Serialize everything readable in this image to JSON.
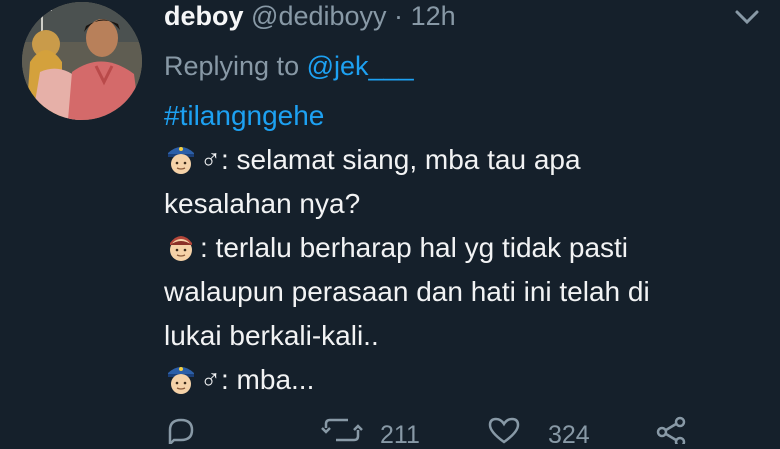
{
  "tweet": {
    "display_name": "deboy",
    "handle": "@dediboyy",
    "separator": "·",
    "time": "12h",
    "replying_prefix": "Replying to",
    "replying_to": "@jek___",
    "hashtag": "#tilangngehe",
    "lines": [
      {
        "emoji": "police-officer-icon",
        "text": "♂: selamat siang, mba tau apa"
      },
      {
        "emoji": "",
        "text": "kesalahan nya?"
      },
      {
        "emoji": "person-face-icon",
        "text": ": terlalu berharap hal yg tidak pasti"
      },
      {
        "emoji": "",
        "text": "walaupun perasaan dan hati ini telah di"
      },
      {
        "emoji": "",
        "text": "lukai berkali-kali.."
      },
      {
        "emoji": "police-officer-icon",
        "text": "♂: mba..."
      }
    ]
  },
  "actions": {
    "retweet_count": "211",
    "like_count": "324"
  },
  "colors": {
    "background": "#15202b",
    "link": "#1da1f2",
    "muted": "#8899a6",
    "text": "#f2f3f4"
  }
}
